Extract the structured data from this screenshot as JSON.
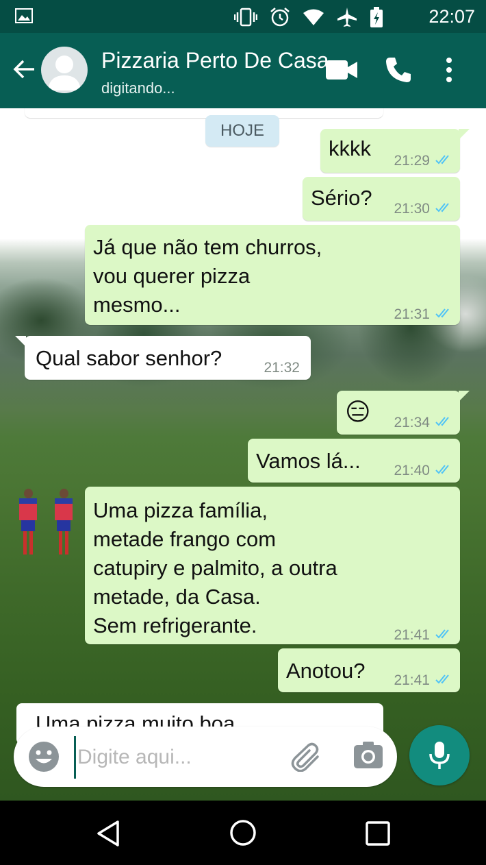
{
  "status_bar": {
    "time": "22:07",
    "icons": [
      "gallery-icon",
      "vibrate-icon",
      "alarm-icon",
      "wifi-icon",
      "airplane-icon",
      "battery-icon"
    ]
  },
  "header": {
    "contact_name": "Pizzaria Perto De Casa",
    "contact_status": "digitando...",
    "actions": [
      "back-arrow-icon",
      "video-call-icon",
      "phone-icon",
      "more-vert-icon"
    ],
    "color": "#075e54"
  },
  "chat": {
    "date_chip": "HOJE",
    "messages": [
      {
        "dir": "out",
        "text": "kkkk",
        "time": "21:29",
        "read": true
      },
      {
        "dir": "out",
        "text": "Sério?",
        "time": "21:30",
        "read": true
      },
      {
        "dir": "out",
        "text": "Já que não tem churros,\nvou querer pizza\nmesmo...",
        "time": "21:31",
        "read": true
      },
      {
        "dir": "in",
        "text": "Qual sabor senhor?",
        "time": "21:32"
      },
      {
        "dir": "out",
        "text": "😑",
        "time": "21:34",
        "read": true
      },
      {
        "dir": "out",
        "text": "Vamos lá...",
        "time": "21:40",
        "read": true
      },
      {
        "dir": "out",
        "text": "Uma pizza família,\nmetade frango com\ncatupiry e palmito, a outra\nmetade, da Casa.\nSem refrigerante.",
        "time": "21:41",
        "read": true
      },
      {
        "dir": "out",
        "text": "Anotou?",
        "time": "21:41",
        "read": true
      }
    ],
    "partial_incoming_text": "Uma pizza muito boa",
    "outgoing_bubble_color": "#dcf8c6",
    "read_tick_color": "#4fc3f7"
  },
  "composer": {
    "placeholder": "Digite aqui...",
    "icons": [
      "emoji-icon",
      "attach-icon",
      "camera-icon",
      "mic-icon"
    ],
    "mic_color": "#128c7e"
  },
  "nav_bar": {
    "buttons": [
      "nav-back-icon",
      "nav-home-icon",
      "nav-recent-icon"
    ]
  }
}
